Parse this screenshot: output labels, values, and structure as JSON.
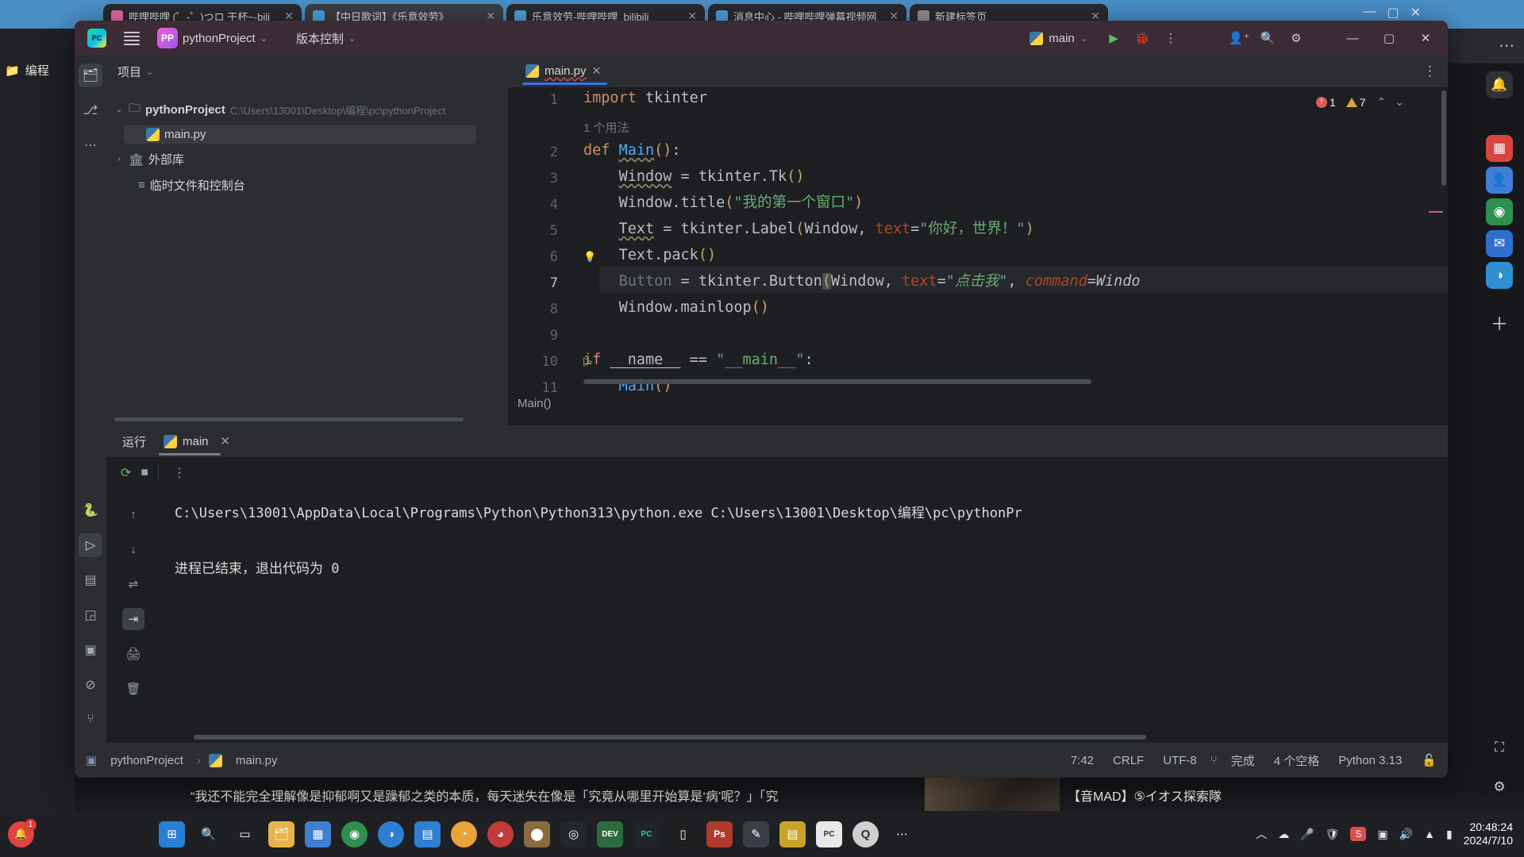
{
  "browser": {
    "tabs": [
      {
        "label": "哔哩哔哩 (゜-゜)つロ 干杯~-bili",
        "active": false,
        "color": "#e86aa6"
      },
      {
        "label": "【中日歌词】《乐意效劳》",
        "active": true,
        "color": "#4aa3df"
      },
      {
        "label": "乐意效劳-哔哩哔哩_bilibili",
        "active": false,
        "color": "#4aa3df"
      },
      {
        "label": "消息中心 - 哔哩哔哩弹幕视频网",
        "active": false,
        "color": "#4aa3df"
      },
      {
        "label": "新建标签页",
        "active": false,
        "color": "#8e9196"
      }
    ],
    "brand": "bili",
    "explorer_label": "编程",
    "bottom_caption": "“我还不能完全理解像是抑郁啊又是躁郁之类的本质，每天迷失在像是「究竟从哪里开始算是‘病’呢？」「究",
    "bottom_caption_right": "【音MAD】⑤イオス探索隊",
    "rail_icons": [
      "bell-icon",
      "grid-icon",
      "person-icon",
      "chrome-icon",
      "mail-icon",
      "edge-icon",
      "plus-icon"
    ]
  },
  "ide": {
    "titlebar": {
      "app_icon": "pycharm-icon",
      "menu_icon": "hamburger-menu-icon",
      "project_badge": "PP",
      "project_name": "pythonProject",
      "vcs_label": "版本控制",
      "run_config": "main",
      "run_icon": "run-icon",
      "debug_icon": "debug-icon",
      "more_icon": "more-options-icon",
      "add_user_icon": "add-user-icon",
      "search_icon": "search-icon",
      "settings_icon": "settings-gear-icon",
      "minimize": "—",
      "maximize": "▢",
      "close": "✕"
    },
    "activity_bar": [
      {
        "name": "project-tool-icon",
        "glyph": "🗂",
        "selected": true
      },
      {
        "name": "commit-tool-icon",
        "glyph": "⎇",
        "selected": false
      },
      {
        "name": "more-tools-icon",
        "glyph": "…",
        "selected": false
      },
      {
        "name": "python-console-icon",
        "glyph": "🐍",
        "selected": false
      },
      {
        "name": "run-tool-icon",
        "glyph": "▷",
        "selected": true
      },
      {
        "name": "services-icon",
        "glyph": "▤",
        "selected": false
      },
      {
        "name": "structure-icon",
        "glyph": "◲",
        "selected": false
      },
      {
        "name": "terminal-icon",
        "glyph": "▣",
        "selected": false
      },
      {
        "name": "problems-icon",
        "glyph": "⊘",
        "selected": false
      },
      {
        "name": "version-control-icon",
        "glyph": "⑂",
        "selected": false
      }
    ],
    "project_panel": {
      "title": "项目",
      "root": {
        "name": "pythonProject",
        "path": "C:\\Users\\13001\\Desktop\\编程\\pc\\pythonProject"
      },
      "children": [
        {
          "label": "main.py",
          "icon": "python-file-icon",
          "selected": true
        },
        {
          "label": "外部库",
          "icon": "library-icon",
          "selected": false
        },
        {
          "label": "临时文件和控制台",
          "icon": "scratches-icon",
          "selected": false
        }
      ]
    },
    "editor": {
      "tab": {
        "label": "main.py",
        "icon": "python-file-icon",
        "close": "✕"
      },
      "more_icon": "editor-options-icon",
      "error_count": "1",
      "warning_count": "7",
      "usage_hint": "1 个用法",
      "breadcrumb": "Main()",
      "lines": [
        {
          "n": "1",
          "text": "import tkinter"
        },
        {
          "n": "2",
          "text": "def Main():"
        },
        {
          "n": "3",
          "text": "    Window = tkinter.Tk()"
        },
        {
          "n": "4",
          "text": "    Window.title(\"我的第一个窗口\")"
        },
        {
          "n": "5",
          "text": "    Text = tkinter.Label(Window, text=\"你好，世界！\")"
        },
        {
          "n": "6",
          "text": "    Text.pack()"
        },
        {
          "n": "7",
          "text": "    Button = tkinter.Button(Window, text=\"点击我\", command=Windo"
        },
        {
          "n": "8",
          "text": "    Window.mainloop()"
        },
        {
          "n": "9",
          "text": ""
        },
        {
          "n": "10",
          "text": "if __name__ == \"__main__\":"
        },
        {
          "n": "11",
          "text": "    Main()"
        }
      ]
    },
    "run_panel": {
      "tool_label": "运行",
      "tab_label": "main",
      "tab_close": "✕",
      "rerun_icon": "rerun-icon",
      "stop_icon": "stop-icon",
      "more_icon": "run-more-icon",
      "side_icons": [
        "scroll-up-icon",
        "scroll-down-icon",
        "soft-wrap-icon",
        "scroll-to-end-icon",
        "print-icon",
        "clear-all-icon"
      ],
      "console_line1": "C:\\Users\\13001\\AppData\\Local\\Programs\\Python\\Python313\\python.exe C:\\Users\\13001\\Desktop\\编程\\pc\\pythonPr",
      "console_line2": "进程已结束，退出代码为 0"
    },
    "status_bar": {
      "crumb_project": "pythonProject",
      "crumb_sep": "›",
      "crumb_file": "main.py",
      "caret": "7:42",
      "line_sep": "CRLF",
      "encoding": "UTF-8",
      "git_icon": "branch-icon",
      "git_label": "完成",
      "indent": "4 个空格",
      "interpreter": "Python 3.13",
      "lock_icon": "lock-icon"
    }
  },
  "taskbar": {
    "start_badge": "1",
    "icons": [
      {
        "name": "start-windows-icon",
        "glyph": "⊞",
        "bg": "#2a7fd4"
      },
      {
        "name": "search-icon",
        "glyph": "🔍",
        "bg": "transparent"
      },
      {
        "name": "task-view-icon",
        "glyph": "▭",
        "bg": "transparent"
      },
      {
        "name": "file-explorer-icon",
        "glyph": "🗂",
        "bg": "transparent"
      },
      {
        "name": "store-icon",
        "glyph": "▦",
        "bg": "transparent"
      },
      {
        "name": "chrome-icon",
        "glyph": "◉",
        "bg": "transparent"
      },
      {
        "name": "edge-icon",
        "glyph": "◑",
        "bg": "transparent"
      },
      {
        "name": "notepad-icon",
        "glyph": "▤",
        "bg": "#2f7fd0"
      },
      {
        "name": "chat-icon",
        "glyph": "◔",
        "bg": "transparent"
      },
      {
        "name": "wechat-icon",
        "glyph": "◕",
        "bg": "#4bbd4b"
      },
      {
        "name": "media-icon",
        "glyph": "⬤",
        "bg": "#c8923a"
      },
      {
        "name": "steam-icon",
        "glyph": "◎",
        "bg": "#23282e"
      },
      {
        "name": "devc-icon",
        "glyph": "DEV",
        "bg": "#2d6a3e"
      },
      {
        "name": "pycharm-icon",
        "glyph": "PC",
        "bg": "#20252b"
      },
      {
        "name": "terminal-icon",
        "glyph": "▯",
        "bg": "#1f1f1f"
      },
      {
        "name": "photoshop-icon",
        "glyph": "Ps",
        "bg": "#b03a2e"
      },
      {
        "name": "editor-icon",
        "glyph": "✎",
        "bg": "#3a3f46"
      },
      {
        "name": "folder-icon",
        "glyph": "▤",
        "bg": "#c9a227"
      },
      {
        "name": "app-icon",
        "glyph": "▥",
        "bg": "#5a5f66"
      },
      {
        "name": "pycharm2-icon",
        "glyph": "PC",
        "bg": "#e8e8e8"
      },
      {
        "name": "qq-icon",
        "glyph": "Q",
        "bg": "#cfcfcf"
      },
      {
        "name": "overflow-icon",
        "glyph": "⋯",
        "bg": "transparent"
      }
    ],
    "tray": [
      {
        "name": "show-hidden-icons",
        "glyph": "︿"
      },
      {
        "name": "cloud-icon",
        "glyph": "☁"
      },
      {
        "name": "mic-icon",
        "glyph": "🎤"
      },
      {
        "name": "shield-icon",
        "glyph": "🛡"
      },
      {
        "name": "sogou-icon",
        "glyph": "S"
      },
      {
        "name": "screenshot-icon",
        "glyph": "▣"
      },
      {
        "name": "volume-icon",
        "glyph": "🔊"
      },
      {
        "name": "wifi-icon",
        "glyph": "▲"
      },
      {
        "name": "battery-icon",
        "glyph": "▮"
      }
    ],
    "clock_time": "20:48:24",
    "clock_date": "2024/7/10",
    "notification_icon": "notification-bell-icon"
  },
  "colors": {
    "accent": "#3574f0",
    "title_bg": "#3b2c35",
    "panel_bg": "#2b2d30",
    "editor_bg": "#1e1f22",
    "string_green": "#6aab73",
    "keyword_orange": "#cf8e6d",
    "func_blue": "#56a8f5",
    "bili_blue": "#00a1d6"
  }
}
